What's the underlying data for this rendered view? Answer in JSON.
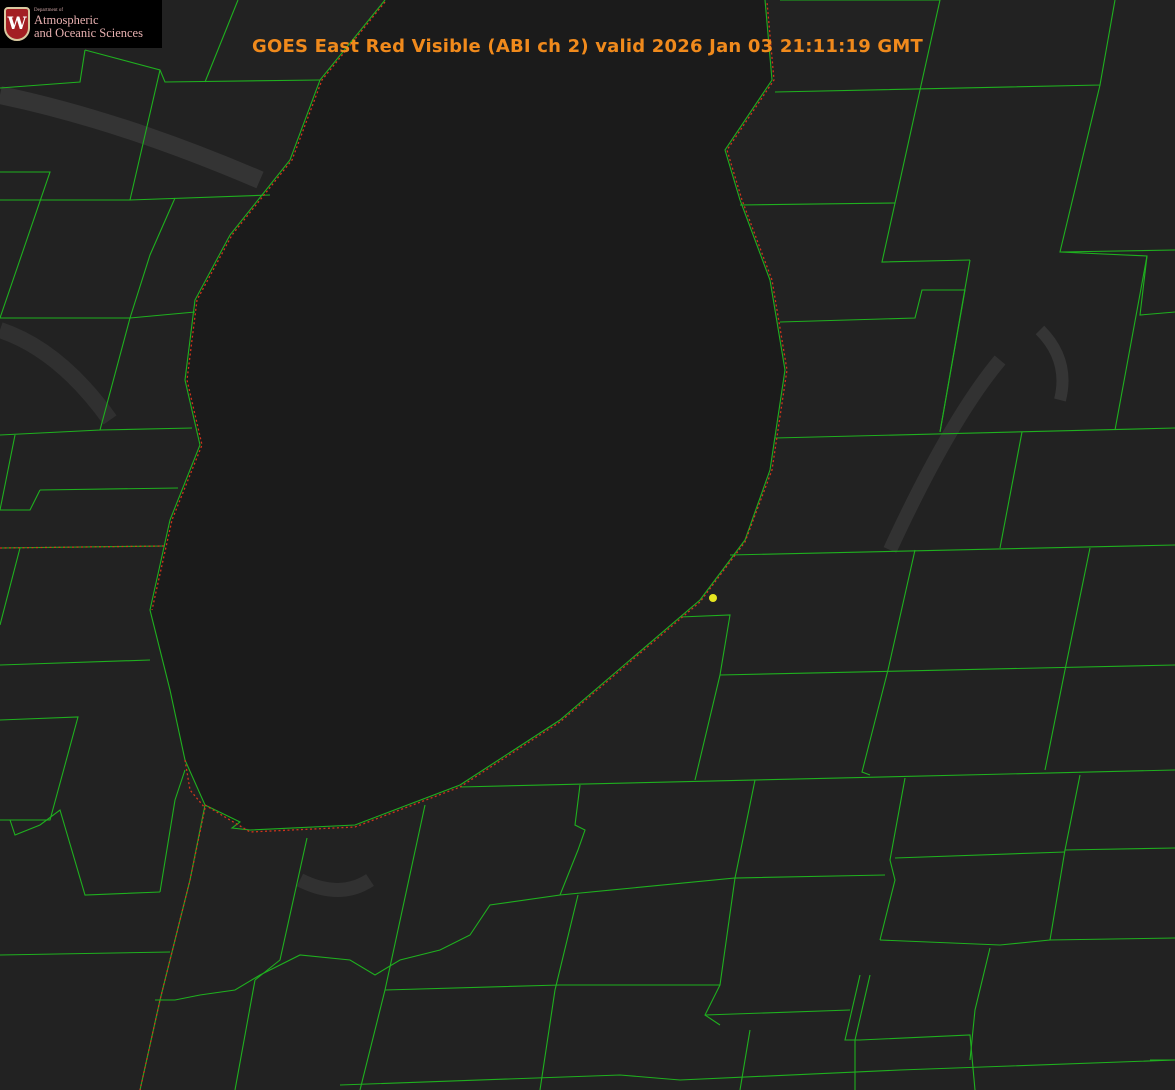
{
  "header": {
    "title": "GOES East Red Visible (ABI ch 2) valid 2026 Jan 03 21:11:19 GMT"
  },
  "logo": {
    "crest_letter": "W",
    "department": "Department of",
    "line1": "Atmospheric",
    "line2": "and Oceanic Sciences"
  },
  "map": {
    "layers": [
      "county-boundaries",
      "lake-shoreline",
      "state-boundaries",
      "station-marker"
    ],
    "colors": {
      "background": "#1e1e1e",
      "lake": "#1a1a1a",
      "county_lines": "#1fb01f",
      "state_lines": "#d0341c",
      "station": "#e6e620",
      "title": "#f08a1c"
    }
  }
}
